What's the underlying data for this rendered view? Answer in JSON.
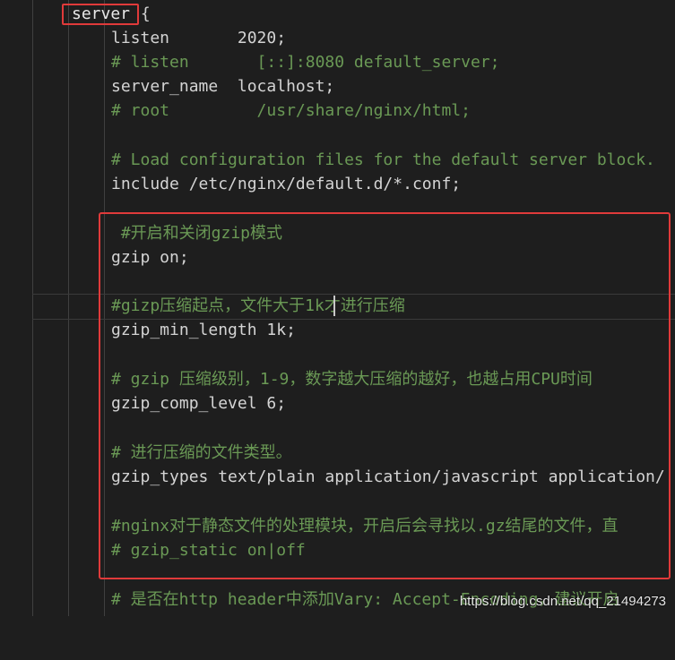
{
  "lines": {
    "l1_kw": "server",
    "l1_brace": " {",
    "l2": "listen       2020;",
    "l3": "# listen       [::]:8080 default_server;",
    "l4": "server_name  localhost;",
    "l5": "# root         /usr/share/nginx/html;",
    "l7": "# Load configuration files for the default server block.",
    "l8": "include /etc/nginx/default.d/*.conf;",
    "l10": " #开启和关闭gzip模式",
    "l11": "gzip on;",
    "l13": "#gizp压缩起点，文件大于1k才进行压缩",
    "l14": "gzip_min_length 1k;",
    "l16": "# gzip 压缩级别，1-9，数字越大压缩的越好，也越占用CPU时间",
    "l17": "gzip_comp_level 6;",
    "l19": "# 进行压缩的文件类型。",
    "l20": "gzip_types text/plain application/javascript application/",
    "l22": "#nginx对于静态文件的处理模块，开启后会寻找以.gz结尾的文件，直",
    "l23": "# gzip_static on|off",
    "l25": "# 是否在http header中添加Vary: Accept-Encoding，建议开启"
  },
  "watermark": "https://blog.csdn.net/qq_21494273",
  "colors": {
    "background": "#1e1e1e",
    "text": "#d4d4d4",
    "comment": "#6a9955",
    "highlight_box": "#e03a3a"
  }
}
